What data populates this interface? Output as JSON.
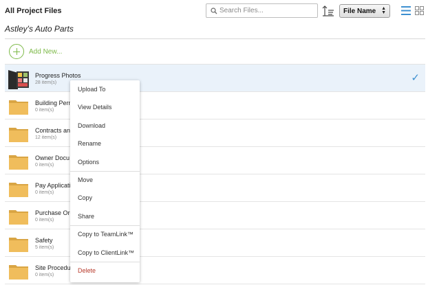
{
  "header": {
    "title": "All Project Files",
    "search_placeholder": "Search Files...",
    "sort_value": "File Name"
  },
  "project": {
    "name": "Astley's Auto Parts"
  },
  "add_new": {
    "label": "Add New..."
  },
  "files": [
    {
      "name": "Progress Photos",
      "count": "28 item(s)",
      "type": "photos",
      "selected": true
    },
    {
      "name": "Building Perm",
      "count": "0 item(s)",
      "type": "folder"
    },
    {
      "name": "Contracts an",
      "count": "12 item(s)",
      "type": "folder"
    },
    {
      "name": "Owner Docu",
      "count": "0 item(s)",
      "type": "folder"
    },
    {
      "name": "Pay Applicati",
      "count": "0 item(s)",
      "type": "folder"
    },
    {
      "name": "Purchase Ord",
      "count": "0 item(s)",
      "type": "folder"
    },
    {
      "name": "Safety",
      "count": "5 item(s)",
      "type": "folder"
    },
    {
      "name": "Site Procedu",
      "count": "0 item(s)",
      "type": "folder"
    }
  ],
  "selected_mark": "✓",
  "context_menu": {
    "items": [
      {
        "label": "Upload To"
      },
      {
        "label": "View Details"
      },
      {
        "label": "Download"
      },
      {
        "label": "Rename"
      },
      {
        "label": "Options"
      },
      {
        "label": "Move"
      },
      {
        "label": "Copy"
      },
      {
        "label": "Share"
      },
      {
        "label": "Copy to TeamLink™"
      },
      {
        "label": "Copy to ClientLink™"
      },
      {
        "label": "Delete"
      }
    ]
  },
  "colors": {
    "accent_green": "#7cb947",
    "selection_blue": "#eaf2fa",
    "check_blue": "#3c8fd0",
    "delete_red": "#b7392a",
    "folder_orange": "#f0bd5c"
  }
}
